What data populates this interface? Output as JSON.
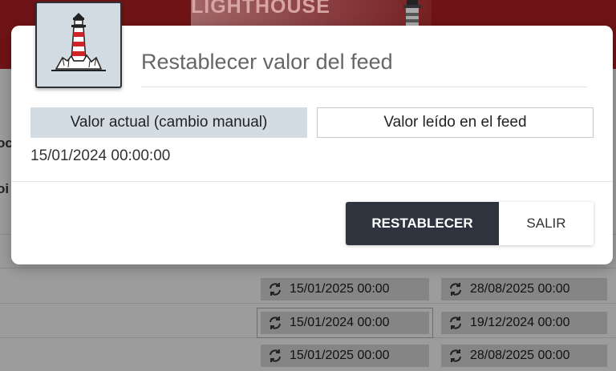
{
  "background": {
    "brand_text": "LIGHTHOUSE",
    "left_fragments": [
      "oc",
      "oi"
    ],
    "rows": [
      {
        "feed_date": "15/01/2025 00:00",
        "other_date": "28/08/2025 00:00"
      },
      {
        "feed_date": "15/01/2024 00:00",
        "other_date": "19/12/2024 00:00"
      },
      {
        "feed_date": "15/01/2025 00:00",
        "other_date": "28/08/2025 00:00"
      }
    ]
  },
  "modal": {
    "title": "Restablecer valor del feed",
    "tabs": [
      {
        "label": "Valor actual (cambio manual)",
        "active": true
      },
      {
        "label": "Valor leído en el feed",
        "active": false
      }
    ],
    "current_value": "15/01/2024 00:00:00",
    "buttons": {
      "reset_label": "RESTABLECER",
      "exit_label": "SALIR"
    }
  },
  "colors": {
    "header_bg": "#6f1416",
    "primary_button": "#2f333d",
    "active_tab": "#d3dce2",
    "logo_bg": "#d2dbe2",
    "lighthouse_red": "#d0232a"
  },
  "icons": {
    "logo": "lighthouse-icon",
    "row_sync": "sync-icon"
  }
}
